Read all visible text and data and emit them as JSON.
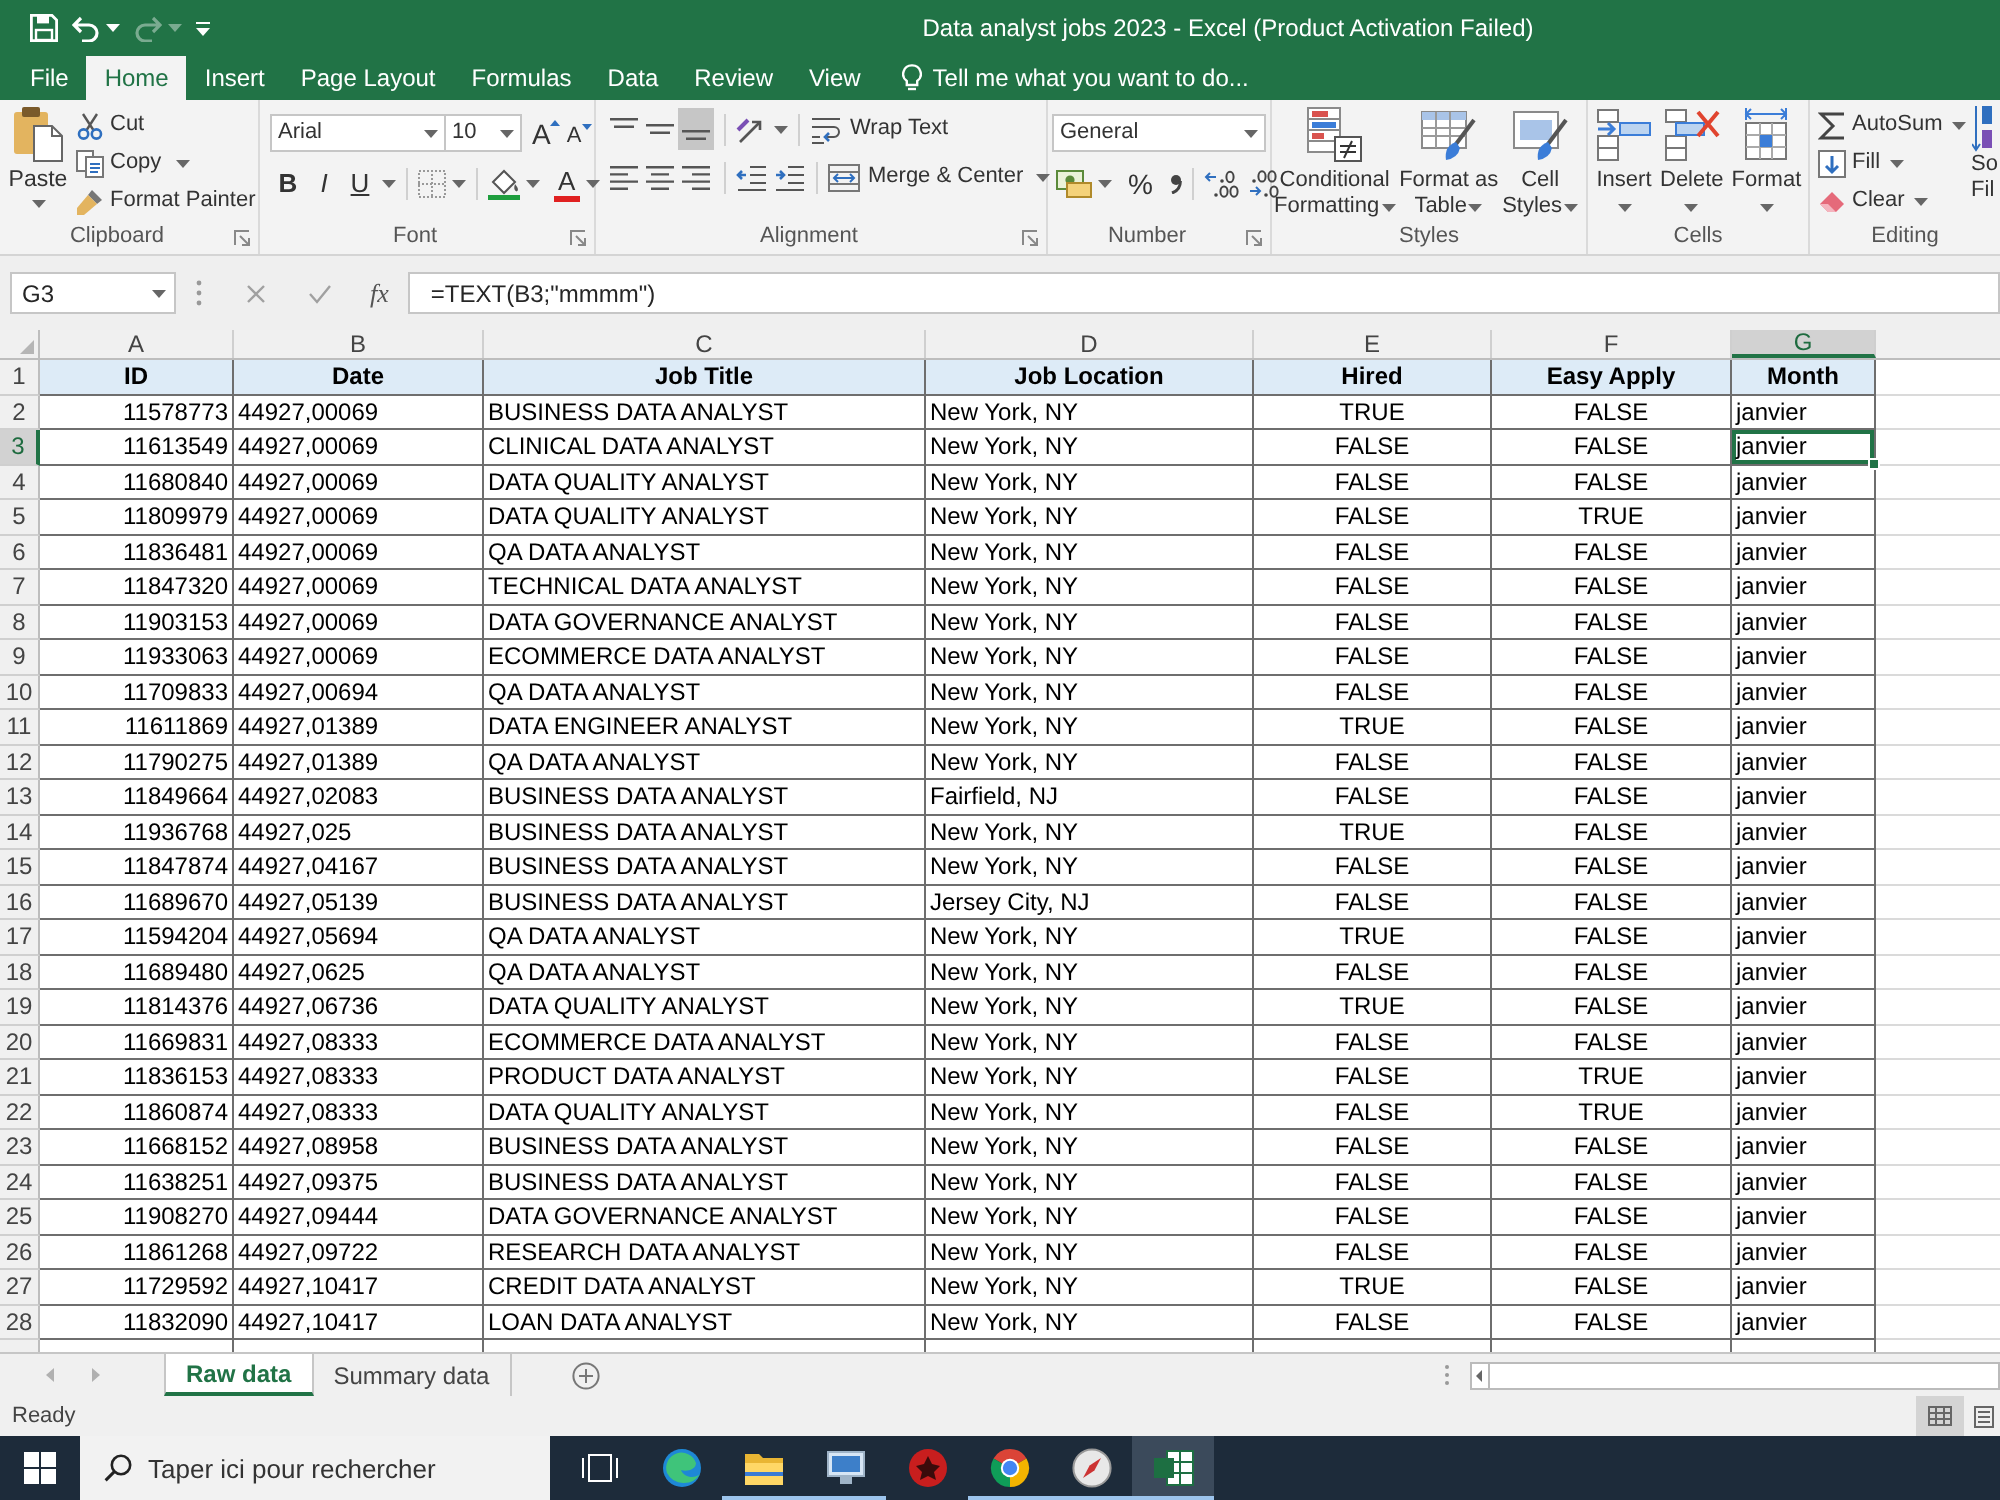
{
  "window": {
    "title": "Data analyst jobs 2023 - Excel (Product Activation Failed)"
  },
  "quick_access": [
    {
      "kind": "save",
      "disabled": false
    },
    {
      "kind": "undo",
      "disabled": false
    },
    {
      "kind": "redo",
      "disabled": true
    },
    {
      "kind": "customize",
      "disabled": false
    }
  ],
  "ribbon_tabs": [
    {
      "label": "File",
      "selected": false
    },
    {
      "label": "Home",
      "selected": true
    },
    {
      "label": "Insert",
      "selected": false
    },
    {
      "label": "Page Layout",
      "selected": false
    },
    {
      "label": "Formulas",
      "selected": false
    },
    {
      "label": "Data",
      "selected": false
    },
    {
      "label": "Review",
      "selected": false
    },
    {
      "label": "View",
      "selected": false
    }
  ],
  "tell_me": {
    "placeholder": "Tell me what you want to do..."
  },
  "ribbon": {
    "clipboard": {
      "label": "Clipboard",
      "paste": "Paste",
      "items": [
        {
          "kind": "cut",
          "label": "Cut"
        },
        {
          "kind": "copy",
          "label": "Copy"
        },
        {
          "kind": "format_painter",
          "label": "Format Painter"
        }
      ]
    },
    "font": {
      "label": "Font",
      "font_name": "Arial",
      "font_size": "10",
      "grow": "A",
      "shrink": "A",
      "styles": [
        {
          "kind": "bold",
          "label": "B"
        },
        {
          "kind": "italic",
          "label": "I"
        },
        {
          "kind": "underline",
          "label": "U"
        }
      ],
      "font_color": "A"
    },
    "alignment": {
      "label": "Alignment",
      "vertical": [
        {
          "kind": "top",
          "selected": false
        },
        {
          "kind": "middle",
          "selected": false
        },
        {
          "kind": "bottom",
          "selected": true
        }
      ],
      "horizontal": [
        {
          "kind": "left",
          "selected": false
        },
        {
          "kind": "center",
          "selected": false
        },
        {
          "kind": "right",
          "selected": false
        }
      ],
      "wrap_text": "Wrap Text",
      "merge": "Merge & Center"
    },
    "number": {
      "label": "Number",
      "format": "General",
      "percent": "%"
    },
    "styles": {
      "label": "Styles",
      "buttons": [
        {
          "kind": "conditional",
          "lines": [
            "Conditional",
            "Formatting"
          ]
        },
        {
          "kind": "table",
          "lines": [
            "Format as",
            "Table"
          ]
        },
        {
          "kind": "cell_styles",
          "lines": [
            "Cell",
            "Styles"
          ]
        }
      ]
    },
    "cells": {
      "label": "Cells",
      "buttons": [
        {
          "kind": "insert",
          "label": "Insert"
        },
        {
          "kind": "delete",
          "label": "Delete"
        },
        {
          "kind": "format",
          "label": "Format"
        }
      ]
    },
    "editing": {
      "label": "Editing",
      "items": [
        {
          "kind": "autosum",
          "label": "AutoSum"
        },
        {
          "kind": "fill",
          "label": "Fill"
        },
        {
          "kind": "clear",
          "label": "Clear"
        }
      ],
      "sort_lines": [
        "So",
        "Fil"
      ]
    }
  },
  "formula_bar": {
    "name_box": "G3",
    "function_label": "fx",
    "formula": "=TEXT(B3;\"mmmm\")"
  },
  "sheet": {
    "columns": [
      {
        "letter": "A",
        "selected": false
      },
      {
        "letter": "B",
        "selected": false
      },
      {
        "letter": "C",
        "selected": false
      },
      {
        "letter": "D",
        "selected": false
      },
      {
        "letter": "E",
        "selected": false
      },
      {
        "letter": "F",
        "selected": false
      },
      {
        "letter": "G",
        "selected": true
      }
    ],
    "rows": [
      {
        "number": "1",
        "kind": "header",
        "selected": false,
        "cells": [
          "ID",
          "Date",
          "Job Title",
          "Job Location",
          "Hired",
          "Easy Apply",
          "Month"
        ]
      },
      {
        "number": "2",
        "kind": "data",
        "selected": false,
        "cells": [
          "11578773",
          "44927,00069",
          "BUSINESS DATA ANALYST",
          "New York, NY",
          "TRUE",
          "FALSE",
          "janvier"
        ]
      },
      {
        "number": "3",
        "kind": "data",
        "selected": true,
        "cells": [
          "11613549",
          "44927,00069",
          "CLINICAL DATA ANALYST",
          "New York, NY",
          "FALSE",
          "FALSE",
          "janvier"
        ]
      },
      {
        "number": "4",
        "kind": "data",
        "selected": false,
        "cells": [
          "11680840",
          "44927,00069",
          "DATA QUALITY ANALYST",
          "New York, NY",
          "FALSE",
          "FALSE",
          "janvier"
        ]
      },
      {
        "number": "5",
        "kind": "data",
        "selected": false,
        "cells": [
          "11809979",
          "44927,00069",
          "DATA QUALITY ANALYST",
          "New York, NY",
          "FALSE",
          "TRUE",
          "janvier"
        ]
      },
      {
        "number": "6",
        "kind": "data",
        "selected": false,
        "cells": [
          "11836481",
          "44927,00069",
          "QA DATA ANALYST",
          "New York, NY",
          "FALSE",
          "FALSE",
          "janvier"
        ]
      },
      {
        "number": "7",
        "kind": "data",
        "selected": false,
        "cells": [
          "11847320",
          "44927,00069",
          "TECHNICAL DATA ANALYST",
          "New York, NY",
          "FALSE",
          "FALSE",
          "janvier"
        ]
      },
      {
        "number": "8",
        "kind": "data",
        "selected": false,
        "cells": [
          "11903153",
          "44927,00069",
          "DATA GOVERNANCE ANALYST",
          "New York, NY",
          "FALSE",
          "FALSE",
          "janvier"
        ]
      },
      {
        "number": "9",
        "kind": "data",
        "selected": false,
        "cells": [
          "11933063",
          "44927,00069",
          "ECOMMERCE DATA ANALYST",
          "New York, NY",
          "FALSE",
          "FALSE",
          "janvier"
        ]
      },
      {
        "number": "10",
        "kind": "data",
        "selected": false,
        "cells": [
          "11709833",
          "44927,00694",
          "QA DATA ANALYST",
          "New York, NY",
          "FALSE",
          "FALSE",
          "janvier"
        ]
      },
      {
        "number": "11",
        "kind": "data",
        "selected": false,
        "cells": [
          "11611869",
          "44927,01389",
          "DATA ENGINEER ANALYST",
          "New York, NY",
          "TRUE",
          "FALSE",
          "janvier"
        ]
      },
      {
        "number": "12",
        "kind": "data",
        "selected": false,
        "cells": [
          "11790275",
          "44927,01389",
          "QA DATA ANALYST",
          "New York, NY",
          "FALSE",
          "FALSE",
          "janvier"
        ]
      },
      {
        "number": "13",
        "kind": "data",
        "selected": false,
        "cells": [
          "11849664",
          "44927,02083",
          "BUSINESS DATA ANALYST",
          "Fairfield, NJ",
          "FALSE",
          "FALSE",
          "janvier"
        ]
      },
      {
        "number": "14",
        "kind": "data",
        "selected": false,
        "cells": [
          "11936768",
          "44927,025",
          "BUSINESS DATA ANALYST",
          "New York, NY",
          "TRUE",
          "FALSE",
          "janvier"
        ]
      },
      {
        "number": "15",
        "kind": "data",
        "selected": false,
        "cells": [
          "11847874",
          "44927,04167",
          "BUSINESS DATA ANALYST",
          "New York, NY",
          "FALSE",
          "FALSE",
          "janvier"
        ]
      },
      {
        "number": "16",
        "kind": "data",
        "selected": false,
        "cells": [
          "11689670",
          "44927,05139",
          "BUSINESS DATA ANALYST",
          "Jersey City, NJ",
          "FALSE",
          "FALSE",
          "janvier"
        ]
      },
      {
        "number": "17",
        "kind": "data",
        "selected": false,
        "cells": [
          "11594204",
          "44927,05694",
          "QA DATA ANALYST",
          "New York, NY",
          "TRUE",
          "FALSE",
          "janvier"
        ]
      },
      {
        "number": "18",
        "kind": "data",
        "selected": false,
        "cells": [
          "11689480",
          "44927,0625",
          "QA DATA ANALYST",
          "New York, NY",
          "FALSE",
          "FALSE",
          "janvier"
        ]
      },
      {
        "number": "19",
        "kind": "data",
        "selected": false,
        "cells": [
          "11814376",
          "44927,06736",
          "DATA QUALITY ANALYST",
          "New York, NY",
          "TRUE",
          "FALSE",
          "janvier"
        ]
      },
      {
        "number": "20",
        "kind": "data",
        "selected": false,
        "cells": [
          "11669831",
          "44927,08333",
          "ECOMMERCE DATA ANALYST",
          "New York, NY",
          "FALSE",
          "FALSE",
          "janvier"
        ]
      },
      {
        "number": "21",
        "kind": "data",
        "selected": false,
        "cells": [
          "11836153",
          "44927,08333",
          "PRODUCT DATA ANALYST",
          "New York, NY",
          "FALSE",
          "TRUE",
          "janvier"
        ]
      },
      {
        "number": "22",
        "kind": "data",
        "selected": false,
        "cells": [
          "11860874",
          "44927,08333",
          "DATA QUALITY ANALYST",
          "New York, NY",
          "FALSE",
          "TRUE",
          "janvier"
        ]
      },
      {
        "number": "23",
        "kind": "data",
        "selected": false,
        "cells": [
          "11668152",
          "44927,08958",
          "BUSINESS DATA ANALYST",
          "New York, NY",
          "FALSE",
          "FALSE",
          "janvier"
        ]
      },
      {
        "number": "24",
        "kind": "data",
        "selected": false,
        "cells": [
          "11638251",
          "44927,09375",
          "BUSINESS DATA ANALYST",
          "New York, NY",
          "FALSE",
          "FALSE",
          "janvier"
        ]
      },
      {
        "number": "25",
        "kind": "data",
        "selected": false,
        "cells": [
          "11908270",
          "44927,09444",
          "DATA GOVERNANCE ANALYST",
          "New York, NY",
          "FALSE",
          "FALSE",
          "janvier"
        ]
      },
      {
        "number": "26",
        "kind": "data",
        "selected": false,
        "cells": [
          "11861268",
          "44927,09722",
          "RESEARCH DATA ANALYST",
          "New York, NY",
          "FALSE",
          "FALSE",
          "janvier"
        ]
      },
      {
        "number": "27",
        "kind": "data",
        "selected": false,
        "cells": [
          "11729592",
          "44927,10417",
          "CREDIT DATA ANALYST",
          "New York, NY",
          "TRUE",
          "FALSE",
          "janvier"
        ]
      },
      {
        "number": "28",
        "kind": "data",
        "selected": false,
        "cells": [
          "11832090",
          "44927,10417",
          "LOAN DATA ANALYST",
          "New York, NY",
          "FALSE",
          "FALSE",
          "janvier"
        ]
      }
    ]
  },
  "sheet_tabs": [
    {
      "label": "Raw data",
      "selected": true
    },
    {
      "label": "Summary data",
      "selected": false
    }
  ],
  "status_bar": {
    "text": "Ready",
    "views": [
      {
        "kind": "normal",
        "selected": true
      },
      {
        "kind": "page_layout",
        "selected": false
      }
    ]
  },
  "taskbar": {
    "search": {
      "placeholder": "Taper ici pour rechercher"
    },
    "apps": [
      {
        "kind": "task_view",
        "running": false,
        "active": false
      },
      {
        "kind": "wave",
        "running": false,
        "active": false
      },
      {
        "kind": "folder",
        "running": true,
        "active": false
      },
      {
        "kind": "monitor",
        "running": true,
        "active": false
      },
      {
        "kind": "badge",
        "running": false,
        "active": false
      },
      {
        "kind": "ring",
        "running": true,
        "active": false
      },
      {
        "kind": "compass",
        "running": true,
        "active": false
      },
      {
        "kind": "sheet",
        "running": true,
        "active": true
      }
    ]
  }
}
